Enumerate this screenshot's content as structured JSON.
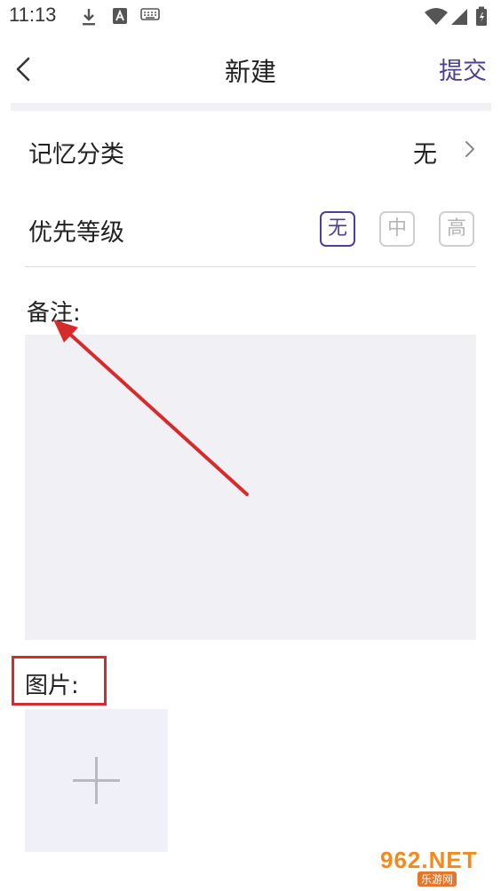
{
  "status_bar": {
    "time": "11:13",
    "left_icons": [
      "download-icon",
      "a-badge-icon",
      "keyboard-icon"
    ],
    "right_icons": [
      "wifi-icon",
      "signal-icon",
      "battery-icon"
    ]
  },
  "header": {
    "back_icon": "chevron-left-icon",
    "title": "新建",
    "submit_label": "提交"
  },
  "form": {
    "category": {
      "label": "记忆分类",
      "value": "无",
      "icon": "chevron-right-icon"
    },
    "priority": {
      "label": "优先等级",
      "options": [
        {
          "label": "无",
          "selected": true
        },
        {
          "label": "中",
          "selected": false
        },
        {
          "label": "高",
          "selected": false
        }
      ]
    },
    "note": {
      "label": "备注:",
      "value": ""
    },
    "image": {
      "label": "图片:",
      "add_icon": "plus-icon"
    }
  },
  "watermark": {
    "top": "962.NET",
    "bottom": "乐游网"
  },
  "colors": {
    "accent": "#4b3f98",
    "input_bg": "#f1f1f5",
    "annotation_red": "#d72b2b"
  }
}
